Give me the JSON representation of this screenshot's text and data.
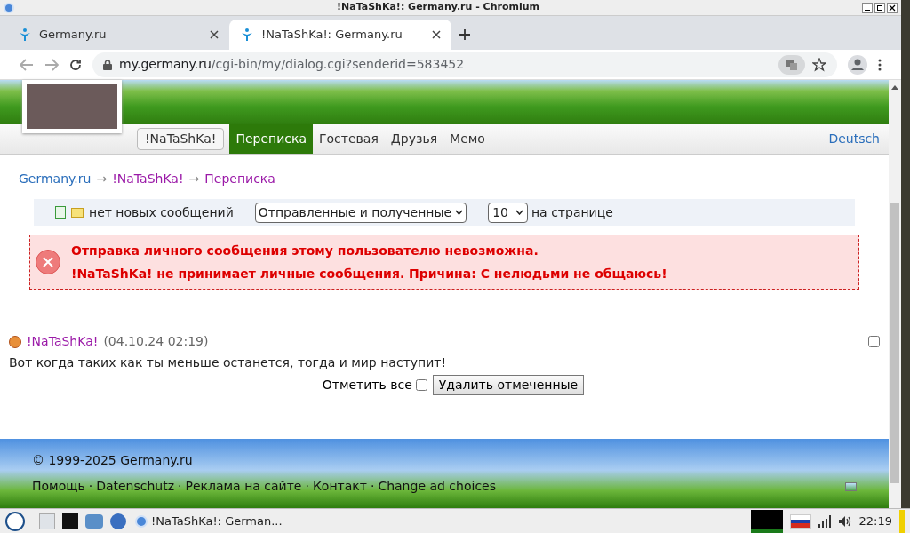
{
  "window": {
    "title": "!NaTaShKa!: Germany.ru - Chromium"
  },
  "tabs": [
    {
      "label": "Germany.ru",
      "selected": false
    },
    {
      "label": "!NaTaShKa!: Germany.ru",
      "selected": true
    }
  ],
  "address": {
    "host": "my.germany.ru",
    "path": "/cgi-bin/my/dialog.cgi?senderid=583452"
  },
  "profile_nav": [
    {
      "label": "!NaTaShKa!",
      "kind": "button",
      "selected": false
    },
    {
      "label": "Переписка",
      "kind": "tab",
      "selected": true
    },
    {
      "label": "Гостевая",
      "kind": "tab",
      "selected": false
    },
    {
      "label": "Друзья",
      "kind": "tab",
      "selected": false
    },
    {
      "label": "Мемо",
      "kind": "tab",
      "selected": false
    }
  ],
  "language_link": "Deutsch",
  "breadcrumb": [
    {
      "label": "Germany.ru",
      "kind": "site"
    },
    {
      "label": "→",
      "kind": "sep"
    },
    {
      "label": "!NaTaShKa!",
      "kind": "user"
    },
    {
      "label": "→",
      "kind": "sep"
    },
    {
      "label": "Переписка",
      "kind": "user"
    }
  ],
  "toolbar": {
    "status": "нет новых сообщений",
    "filter": "Отправленные и полученные",
    "per_page": "10",
    "per_page_label": "на странице"
  },
  "error": [
    "Отправка личного сообщения этому пользователю невозможна.",
    "!NaTaShKa! не принимает личные сообщения. Причина: С нелюдьми не общаюсь!"
  ],
  "messages": [
    {
      "author": "!NaTaShKa!",
      "date": "(04.10.24 02:19)",
      "text": "Вот когда таких как ты меньше останется, тогда и мир наступит!",
      "checked": false
    }
  ],
  "mark_all": {
    "label": "Отметить все",
    "checked": false
  },
  "delete_button": "Удалить отмеченные",
  "footer": {
    "copyright": "© 1999-2025 Germany.ru",
    "separator": "·",
    "links": [
      "Помощь",
      "Datenschutz",
      "Реклама на сайте",
      "Контакт",
      "Change ad choices"
    ]
  },
  "taskbar": {
    "window_title": "!NaTaShKa!: German...",
    "clock": "22:19"
  }
}
